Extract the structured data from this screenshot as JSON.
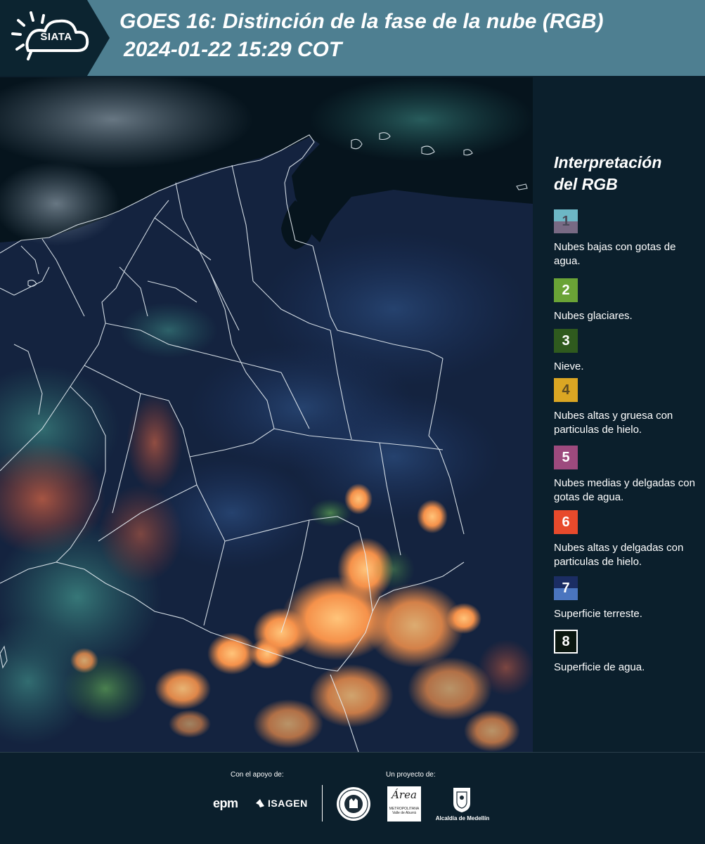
{
  "header": {
    "logo_text": "SIATA",
    "title_line1": "GOES 16: Distinción de la fase de la nube (RGB)",
    "title_line2": "2024-01-22 15:29 COT",
    "colors": {
      "band": "#4e7f91",
      "logo_bg": "#0c2430"
    }
  },
  "legend": {
    "title": "Interpretación del RGB",
    "items": [
      {
        "number": "1",
        "label": "Nubes bajas con gotas de agua.",
        "colors": [
          "#6db7c6",
          "#786a84"
        ]
      },
      {
        "number": "2",
        "label": "Nubes glaciares.",
        "colors": [
          "#6aa336"
        ]
      },
      {
        "number": "3",
        "label": "Nieve.",
        "colors": [
          "#2f5a1e"
        ]
      },
      {
        "number": "4",
        "label": "Nubes altas y gruesa con particulas de hielo.",
        "colors": [
          "#dba623"
        ]
      },
      {
        "number": "5",
        "label": "Nubes medias y delgadas con gotas de agua.",
        "colors": [
          "#9d4a7e"
        ]
      },
      {
        "number": "6",
        "label": "Nubes altas y delgadas con particulas de hielo.",
        "colors": [
          "#e84a2c"
        ]
      },
      {
        "number": "7",
        "label": "Superficie terreste.",
        "colors": [
          "#1b2d63",
          "#4a75bf"
        ]
      },
      {
        "number": "8",
        "label": "Superficie de agua.",
        "colors": [
          "#0b1710"
        ]
      }
    ]
  },
  "map": {
    "image_type": "satellite-rgb-composite",
    "region_icon": "colombia-map-icon"
  },
  "footer": {
    "support_label": "Con el apoyo de:",
    "project_label": "Un proyecto de:",
    "sponsor_epm": "epm",
    "sponsor_isagen": "ISAGEN",
    "area_name": "Área",
    "area_subtitle": "METROPOLITANA Valle de Aburrá",
    "alcaldia": "Alcaldía de Medellín"
  }
}
